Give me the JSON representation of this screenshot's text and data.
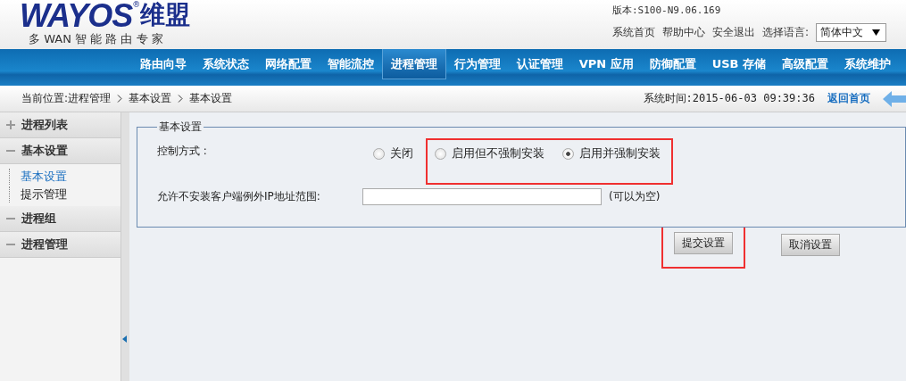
{
  "logo": {
    "brand": "WAYOS",
    "mark": "®",
    "brand_cn": "维盟",
    "tagline": "多 WAN 智 能 路 由 专 家"
  },
  "version": "版本:S100-N9.06.169",
  "top_links": [
    "系统首页",
    "帮助中心",
    "安全退出"
  ],
  "language": {
    "label": "选择语言:",
    "value": "简体中文"
  },
  "nav": [
    {
      "label": "路由向导",
      "selected": false
    },
    {
      "label": "系统状态",
      "selected": false
    },
    {
      "label": "网络配置",
      "selected": false
    },
    {
      "label": "智能流控",
      "selected": false
    },
    {
      "label": "进程管理",
      "selected": true
    },
    {
      "label": "行为管理",
      "selected": false
    },
    {
      "label": "认证管理",
      "selected": false
    },
    {
      "label": "VPN 应用",
      "selected": false
    },
    {
      "label": "防御配置",
      "selected": false
    },
    {
      "label": "USB 存储",
      "selected": false
    },
    {
      "label": "高级配置",
      "selected": false
    },
    {
      "label": "系统维护",
      "selected": false
    }
  ],
  "breadcrumb": [
    "当前位置:进程管理",
    "基本设置",
    "基本设置"
  ],
  "system_time": "系统时间:2015-06-03 09:39:36",
  "back_home": "返回首页",
  "sidebar": [
    {
      "label": "进程列表",
      "expanded": false
    },
    {
      "label": "基本设置",
      "expanded": true,
      "children": [
        {
          "label": "基本设置",
          "selected": true
        },
        {
          "label": "提示管理",
          "selected": false
        }
      ]
    },
    {
      "label": "进程组",
      "expanded": true
    },
    {
      "label": "进程管理",
      "expanded": true
    }
  ],
  "form": {
    "legend": "基本设置",
    "control_label": "控制方式 :",
    "options": [
      {
        "label": "关闭",
        "selected": false,
        "highlighted": false
      },
      {
        "label": "启用但不强制安装",
        "selected": false,
        "highlighted": true
      },
      {
        "label": "启用并强制安装",
        "selected": true,
        "highlighted": true
      }
    ],
    "range_label": "允许不安装客户端例外IP地址范围:",
    "range_hint": "(可以为空)",
    "buttons": [
      {
        "label": "提交设置",
        "highlighted": true
      },
      {
        "label": "取消设置",
        "highlighted": false
      }
    ]
  }
}
